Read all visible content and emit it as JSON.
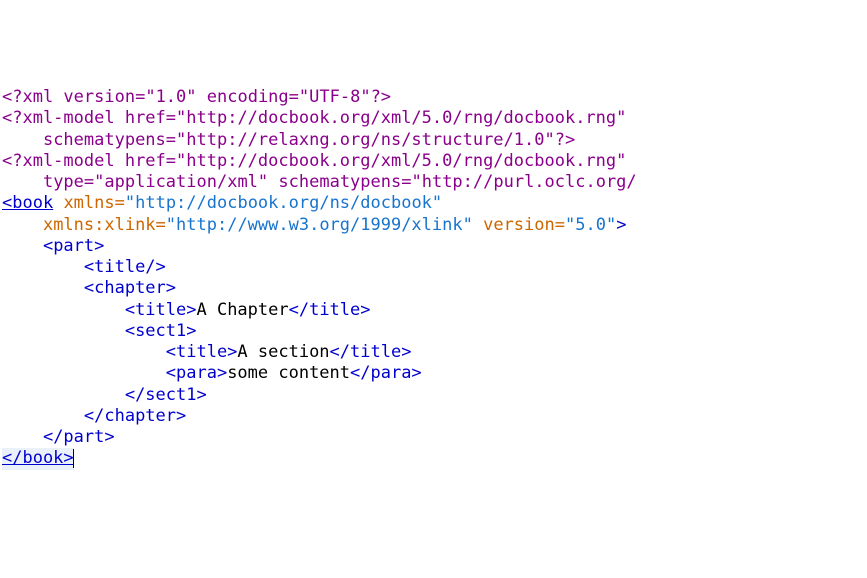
{
  "lines": {
    "l1": {
      "open": "<?xml ",
      "a1": "version",
      "v1": "\"1.0\"",
      "a2": "encoding",
      "v2": "\"UTF-8\"",
      "close": "?>"
    },
    "l2": {
      "open": "<?xml-model ",
      "a1": "href",
      "v1": "\"http://docbook.org/xml/5.0/rng/docbook.rng\""
    },
    "l3": {
      "a1": "schematypens",
      "v1": "\"http://relaxng.org/ns/structure/1.0\"",
      "close": "?>"
    },
    "l4": {
      "open": "<?xml-model ",
      "a1": "href",
      "v1": "\"http://docbook.org/xml/5.0/rng/docbook.rng\""
    },
    "l5": {
      "a1": "type",
      "v1": "\"application/xml\"",
      "a2": "schematypens",
      "v2": "\"http://purl.oclc.org/"
    },
    "l6": {
      "open": "<book",
      "a1": "xmlns",
      "v1": "\"http://docbook.org/ns/docbook\""
    },
    "l7": {
      "a1": "xmlns:xlink",
      "v1": "\"http://www.w3.org/1999/xlink\"",
      "a2": "version",
      "v2": "\"5.0\"",
      "close": ">"
    },
    "l8": {
      "open": "<part>",
      "indent": "    "
    },
    "l9": {
      "open": "<title/>",
      "indent": "        "
    },
    "l10": {
      "open": "<chapter>",
      "indent": "        "
    },
    "l11": {
      "open": "<title>",
      "txt": "A Chapter",
      "close": "</title>",
      "indent": "            "
    },
    "l12": {
      "open": "<sect1>",
      "indent": "            "
    },
    "l13": {
      "open": "<title>",
      "txt": "A section",
      "close": "</title>",
      "indent": "                "
    },
    "l14": {
      "open": "<para>",
      "txt": "some content",
      "close": "</para>",
      "indent": "                "
    },
    "l15": {
      "open": "</sect1>",
      "indent": "            "
    },
    "l16": {
      "open": "</chapter>",
      "indent": "        "
    },
    "l17": {
      "open": "</part>",
      "indent": "    "
    },
    "l18": {
      "open": "</book>"
    }
  }
}
